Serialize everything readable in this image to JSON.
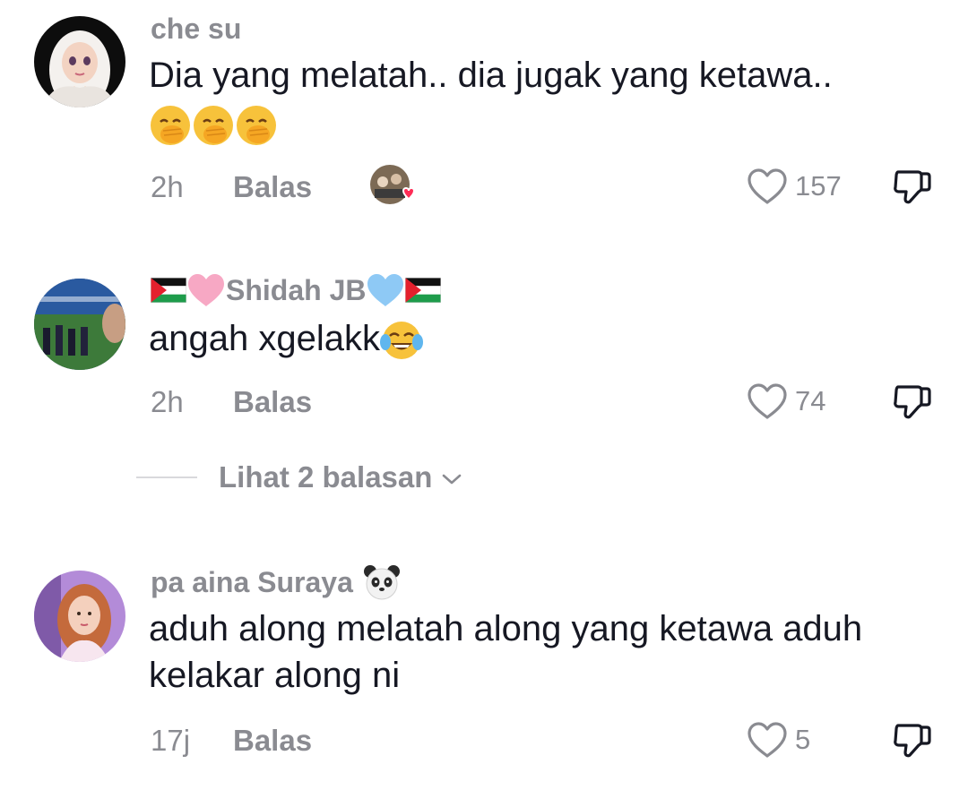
{
  "comments": [
    {
      "username": "che su",
      "text": "Dia yang melatah.. dia jugak yang ketawa..",
      "emojis": [
        "hand-over-mouth",
        "hand-over-mouth",
        "hand-over-mouth"
      ],
      "time": "2h",
      "reply_label": "Balas",
      "likes": "157",
      "creator_liked": true
    },
    {
      "username_prefix_emojis": [
        "palestine-flag",
        "pink-heart"
      ],
      "username": "Shidah JB",
      "username_suffix_emojis": [
        "light-blue-heart",
        "palestine-flag"
      ],
      "text": "angah xgelakk",
      "text_emoji": "tears-of-joy",
      "time": "2h",
      "reply_label": "Balas",
      "likes": "74",
      "view_replies": "Lihat 2 balasan"
    },
    {
      "username": "pa aina Suraya",
      "username_suffix_emoji": "panda",
      "text": "aduh along melatah along yang ketawa aduh kelakar along ni",
      "time": "17j",
      "reply_label": "Balas",
      "likes": "5"
    }
  ],
  "colors": {
    "text_primary": "#161823",
    "text_secondary": "#8a8b91",
    "heart_red": "#fe2c55"
  }
}
